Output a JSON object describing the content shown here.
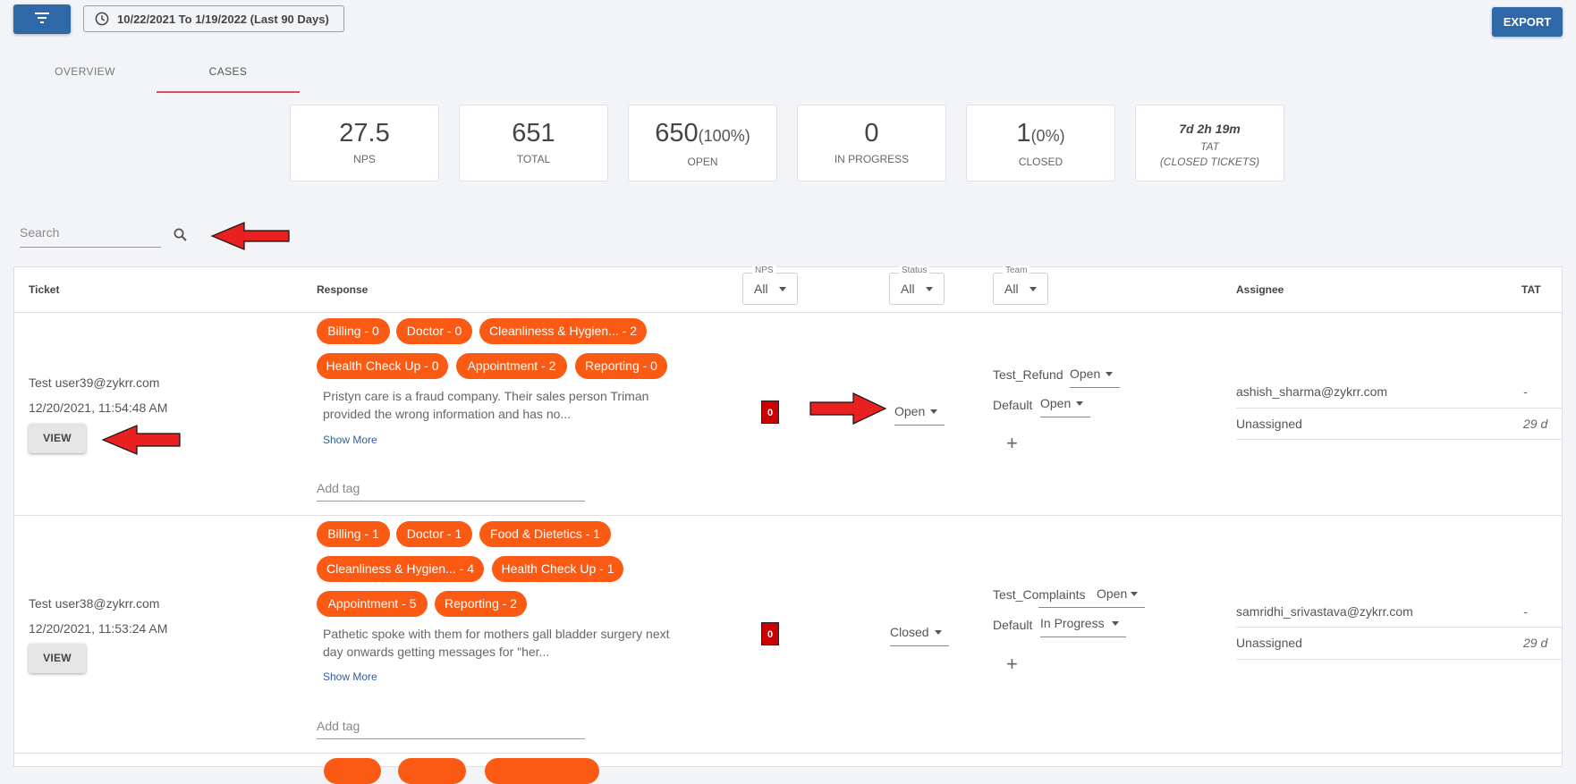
{
  "toolbar": {
    "filter_icon": "filter-list-icon",
    "date_range_label": "10/22/2021 To 1/19/2022 (Last 90 Days)",
    "clock_icon": "clock-icon",
    "export_label": "EXPORT"
  },
  "tabs": [
    {
      "label": "OVERVIEW",
      "active": false
    },
    {
      "label": "CASES",
      "active": true
    }
  ],
  "stats": {
    "nps": {
      "value": "27.5",
      "label": "NPS"
    },
    "total": {
      "value": "651",
      "label": "TOTAL"
    },
    "open": {
      "value": "650",
      "pct": "(100%)",
      "label": "OPEN"
    },
    "in_progress": {
      "value": "0",
      "label": "IN PROGRESS"
    },
    "closed": {
      "value": "1",
      "pct": "(0%)",
      "label": "CLOSED"
    },
    "tat": {
      "value": "7d 2h 19m",
      "label": "TAT",
      "sublabel": "(CLOSED TICKETS)"
    }
  },
  "search": {
    "placeholder": "Search",
    "icon": "search-icon"
  },
  "table": {
    "headers": {
      "ticket": "Ticket",
      "response": "Response",
      "assignee": "Assignee",
      "tat": "TAT"
    },
    "filters": {
      "nps": {
        "label": "NPS",
        "value": "All"
      },
      "status": {
        "label": "Status",
        "value": "All"
      },
      "team": {
        "label": "Team",
        "value": "All"
      }
    },
    "rows": [
      {
        "user": "Test user39@zykrr.com",
        "date": "12/20/2021, 11:54:48 AM",
        "view_label": "VIEW",
        "tags": [
          "Billing - 0",
          "Doctor - 0",
          "Cleanliness & Hygien... - 2",
          "Health Check Up - 0",
          "Appointment - 2",
          "Reporting - 0"
        ],
        "response_line1": "Pristyn care is a fraud company. Their sales person Triman",
        "response_line2": "provided the wrong information and has no...",
        "show_more": "Show More",
        "add_tag_placeholder": "Add tag",
        "nps": "0",
        "status": "Open",
        "teams": [
          {
            "name": "Test_Refund",
            "status": "Open"
          },
          {
            "name": "Default",
            "status": "Open"
          }
        ],
        "add_icon": "plus-icon",
        "assignees": [
          {
            "name": "ashish_sharma@zykrr.com",
            "tat": "-"
          },
          {
            "name": "Unassigned",
            "tat": "29 d"
          }
        ]
      },
      {
        "user": "Test user38@zykrr.com",
        "date": "12/20/2021, 11:53:24 AM",
        "view_label": "VIEW",
        "tags": [
          "Billing - 1",
          "Doctor - 1",
          "Food & Dietetics - 1",
          "Cleanliness & Hygien... - 4",
          "Health Check Up - 1",
          "Appointment - 5",
          "Reporting - 2"
        ],
        "response_line1": "Pathetic spoke with them for mothers gall bladder surgery next",
        "response_line2": "day onwards getting messages for \"her...",
        "show_more": "Show More",
        "add_tag_placeholder": "Add tag",
        "nps": "0",
        "status": "Closed",
        "teams": [
          {
            "name": "Test_Complaints",
            "status": "Open"
          },
          {
            "name": "Default",
            "status": "In Progress"
          }
        ],
        "add_icon": "plus-icon",
        "assignees": [
          {
            "name": "samridhi_srivastava@zykrr.com",
            "tat": "-"
          },
          {
            "name": "Unassigned",
            "tat": "29 d"
          }
        ]
      }
    ]
  },
  "annotation_arrows": [
    "arrow-left-icon",
    "arrow-left-icon",
    "arrow-right-icon"
  ],
  "colors": {
    "primary": "#2e68a8",
    "tag_orange": "#fa5a14",
    "active_tab_underline": "#e04a5a",
    "nps_badge": "#cc0000",
    "annotation_arrow": "#e82020",
    "page_bg": "#f2f4f8"
  }
}
